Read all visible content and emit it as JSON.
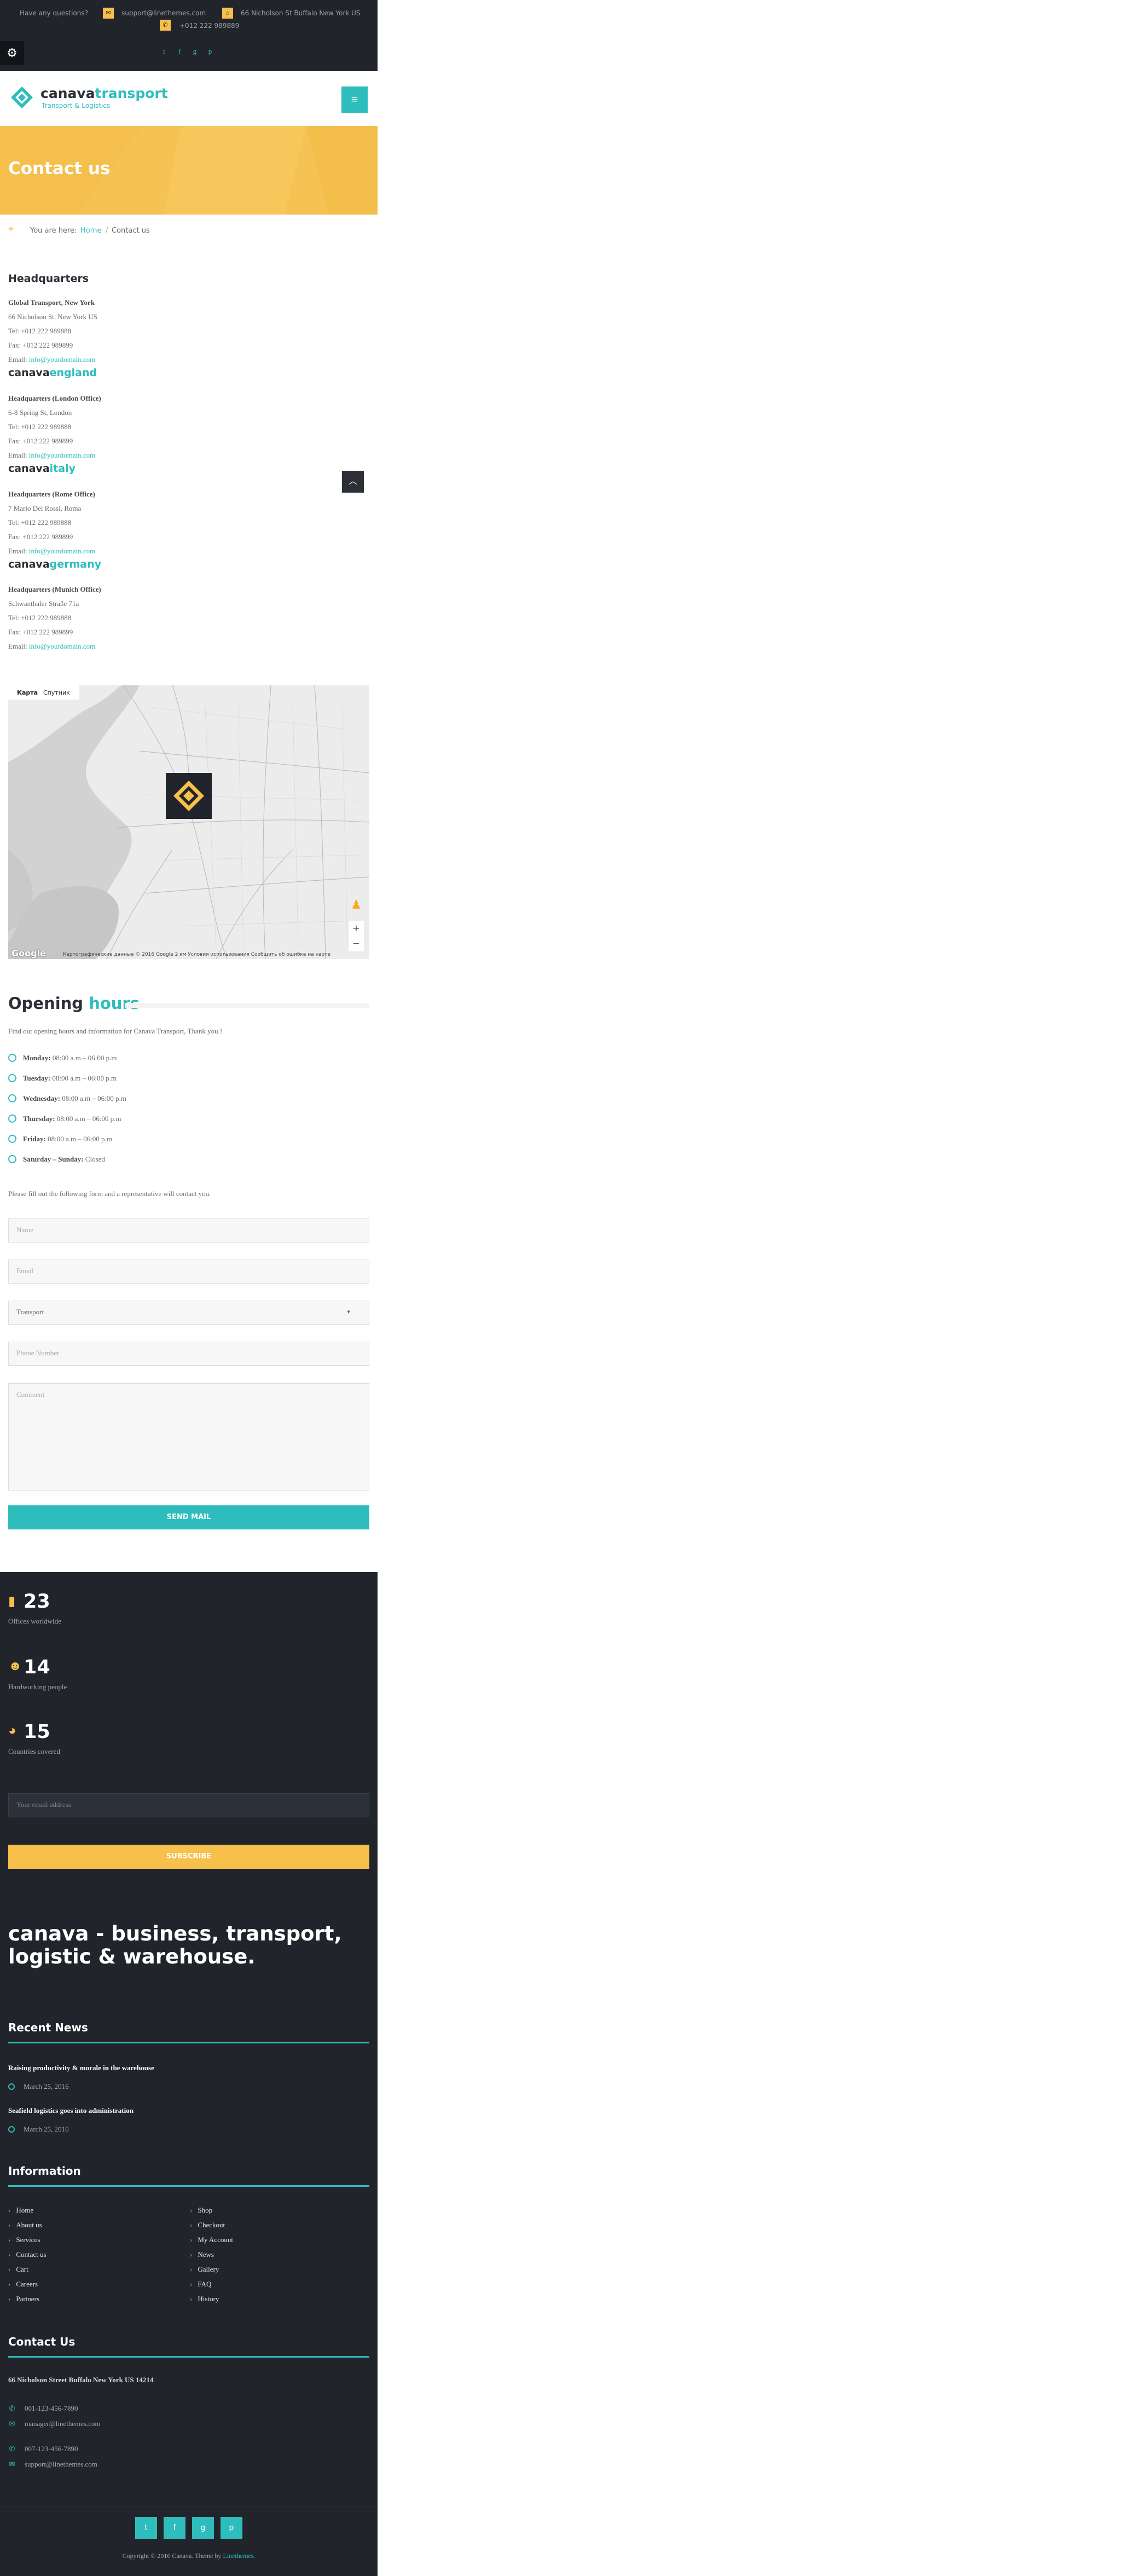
{
  "topbar": {
    "question": "Have any questions?",
    "email": "support@linethemes.com",
    "address": "66 Nicholson St Buffalo New York US",
    "phone": "+012 222 989889"
  },
  "header": {
    "logo_main": "canava",
    "logo_accent": "transport",
    "logo_sub": "Transport & Logistics"
  },
  "hero": {
    "title": "Contact us"
  },
  "breadcrumb": {
    "prefix": "You are here:",
    "home": "Home",
    "sep": "/",
    "current": "Contact us"
  },
  "headquarters": {
    "title": "Headquarters",
    "offices": [
      {
        "name": "Global Transport, New York",
        "address": "66 Nicholson St, New York US",
        "tel": "Tel: +012 222 989888",
        "fax": "Fax: +012 222 989899",
        "email_label": "Email:",
        "email": "info@yourdomain.com"
      },
      {
        "name": "Headquarters (London Office)",
        "address": "6-8 Spring St, London",
        "tel": "Tel: +012 222 989888",
        "fax": "Fax: +012 222 989899",
        "email_label": "Email:",
        "email": "info@yourdomain.com"
      },
      {
        "name": "Headquarters (Rome Office)",
        "address": "7 Mario Dei Rossi, Roma",
        "tel": "Tel: +012 222 989888",
        "fax": "Fax: +012 222 989899",
        "email_label": "Email:",
        "email": "info@yourdomain.com"
      },
      {
        "name": "Headquarters (Munich Office)",
        "address": "Schwanthaler Straße 71a",
        "tel": "Tel: +012 222 989888",
        "fax": "Fax: +012 222 989899",
        "email_label": "Email:",
        "email": "info@yourdomain.com"
      }
    ],
    "brands": [
      {
        "a": "canava",
        "b": "england"
      },
      {
        "a": "canava",
        "b": "italy"
      },
      {
        "a": "canava",
        "b": "germany"
      }
    ]
  },
  "map": {
    "tab_map": "Карта",
    "tab_sat": "Спутник",
    "brand": "Google",
    "footer": "Картографические данные © 2016 Google   2 км   Условия использования   Сообщить об ошибке на карте"
  },
  "hours": {
    "title_a": "Opening",
    "title_b": "hours",
    "intro": "Find out opening hours and information for Canava Transport, Thank you !",
    "items": [
      {
        "day": "Monday:",
        "time": "08:00 a.m – 06:00 p.m"
      },
      {
        "day": "Tuesday:",
        "time": "08:00 a.m – 06:00 p.m"
      },
      {
        "day": "Wednesday:",
        "time": "08:00 a.m – 06:00 p.m"
      },
      {
        "day": "Thursday:",
        "time": "08:00 a.m – 06:00 p.m"
      },
      {
        "day": "Friday:",
        "time": "08:00 a.m – 06:00 p.m"
      },
      {
        "day": "Saturday – Sunday:",
        "time": "Closed"
      }
    ]
  },
  "form": {
    "intro": "Please fill out the following form and a representative will contact you.",
    "name_ph": "Name",
    "email_ph": "Email",
    "select_value": "Transport",
    "phone_ph": "Phone Number",
    "comment_ph": "Comment",
    "send": "SEND MAIL"
  },
  "stats": [
    {
      "num": "23",
      "label": "Offices worldwide"
    },
    {
      "num": "14",
      "label": "Hardworking people"
    },
    {
      "num": "15",
      "label": "Countries covered"
    }
  ],
  "newsletter": {
    "placeholder": "Your email address",
    "button": "SUBSCRIBE"
  },
  "tagline": "canava - business, transport, logistic & warehouse.",
  "recent": {
    "title": "Recent News",
    "posts": [
      {
        "title": "Raising productivity & morale in the warehouse",
        "date": "March 25, 2016"
      },
      {
        "title": "Seafield logistics goes into administration",
        "date": "March 25, 2016"
      }
    ]
  },
  "information": {
    "title": "Information",
    "col1": [
      "Home",
      "About us",
      "Services",
      "Contact us",
      "Cart",
      "Careers",
      "Partners"
    ],
    "col2": [
      "Shop",
      "Checkout",
      "My Account",
      "News",
      "Gallery",
      "FAQ",
      "History"
    ]
  },
  "contact": {
    "title": "Contact Us",
    "address": "66 Nicholson Street Buffalo New York US 14214",
    "lines": [
      {
        "icon": "phone-icon",
        "text": "001-123-456-7890"
      },
      {
        "icon": "mail-icon",
        "text": "manager@linethemes.com"
      },
      {
        "icon": "phone-icon",
        "text": "007-123-456-7890"
      },
      {
        "icon": "mail-icon",
        "text": "support@linethemes.com"
      }
    ]
  },
  "copyright": {
    "text": "Copyright © 2016 Canava. Theme by",
    "link": "Linethemes."
  },
  "colors": {
    "accent": "#2ebdbc",
    "yellow": "#f7c04a",
    "dark": "#21252b"
  }
}
